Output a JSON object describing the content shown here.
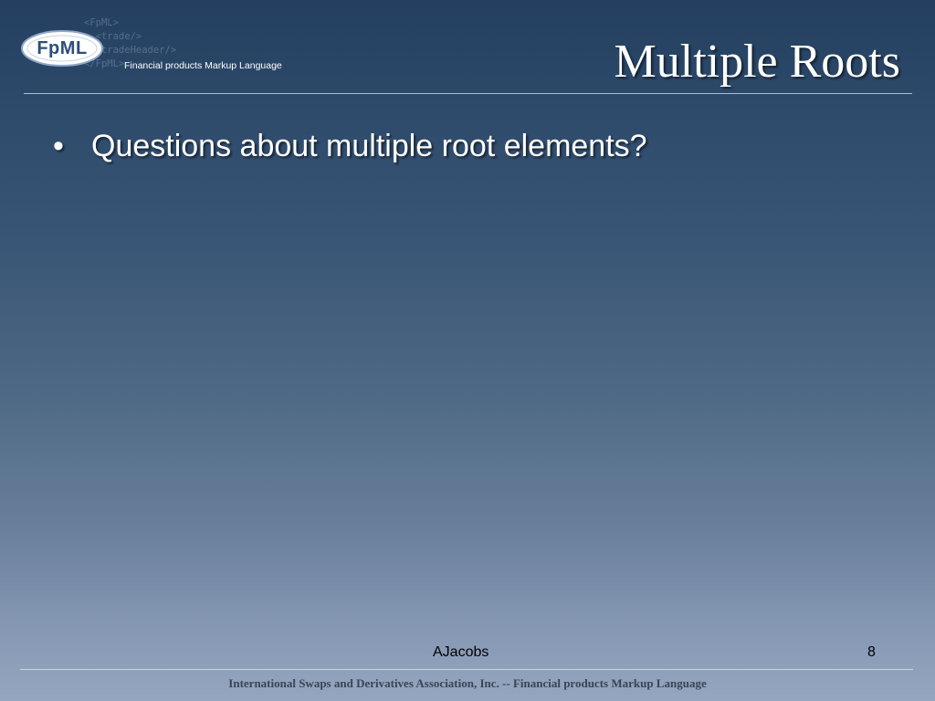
{
  "logo": {
    "badge_text": "FpML",
    "tagline": "Financial products Markup Language",
    "background_code": "<FpML>\n  <trade/>\n  <tradeHeader/>\n</FpML>"
  },
  "slide": {
    "title": "Multiple Roots",
    "bullet_symbol": "•",
    "bullets": [
      "Questions about multiple root elements?"
    ]
  },
  "footer": {
    "author": "AJacobs",
    "page_number": "8",
    "organization": "International Swaps and Derivatives Association, Inc. -- Financial products Markup Language"
  },
  "colors": {
    "background_top": "#243f5f",
    "background_bottom": "#95a6bf",
    "logo_badge": "#ffffff",
    "logo_text": "#2c4f7a"
  }
}
